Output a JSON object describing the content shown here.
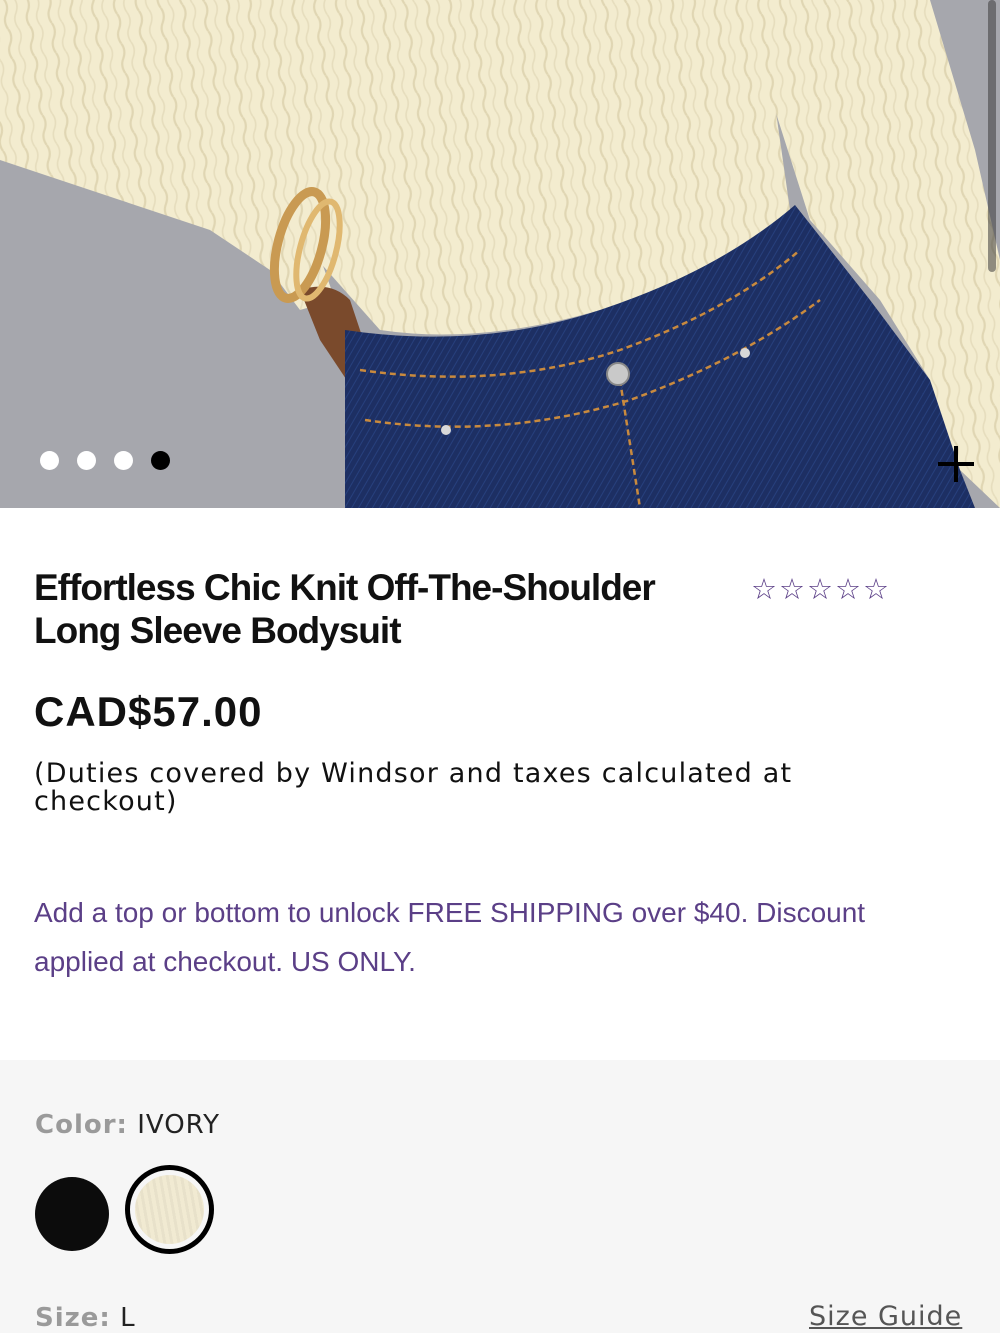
{
  "gallery": {
    "image_label": "Model wearing ivory cable knit bodysuit with dark wash jeans",
    "dots": [
      {
        "active": false
      },
      {
        "active": false
      },
      {
        "active": false
      },
      {
        "active": true
      }
    ],
    "zoom_icon": "plus-icon"
  },
  "product": {
    "title": "Effortless Chic Knit Off-The-Shoulder Long Sleeve Bodysuit",
    "rating_stars": 5,
    "star_icon": "star-outline-icon",
    "price": "CAD$57.00",
    "duties_note": "(Duties covered by Windsor and taxes calculated at checkout)",
    "promo": "Add a top or bottom to unlock FREE SHIPPING over $40. Discount applied at checkout. US ONLY."
  },
  "options": {
    "color_label": "Color:",
    "color_value": "IVORY",
    "size_label": "Size:",
    "size_value": "L",
    "size_guide": "Size Guide"
  },
  "colors": {
    "accent_purple": "#5b3f87",
    "swatch_black": "#0c0c0c",
    "swatch_ivory": "#f1ead2",
    "panel_bg": "#f6f6f6"
  }
}
